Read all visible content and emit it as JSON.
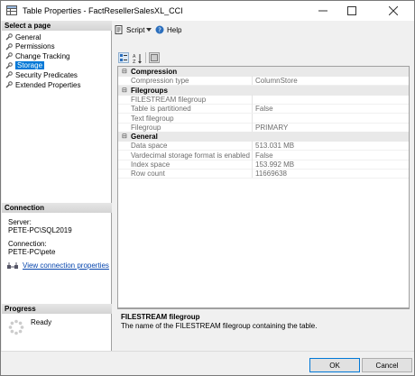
{
  "window": {
    "title": "Table Properties - FactResellerSalesXL_CCI"
  },
  "left": {
    "select_page_header": "Select a page",
    "pages": [
      {
        "label": "General",
        "selected": false
      },
      {
        "label": "Permissions",
        "selected": false
      },
      {
        "label": "Change Tracking",
        "selected": false
      },
      {
        "label": "Storage",
        "selected": true
      },
      {
        "label": "Security Predicates",
        "selected": false
      },
      {
        "label": "Extended Properties",
        "selected": false
      }
    ],
    "connection_header": "Connection",
    "server_label": "Server:",
    "server_value": "PETE-PC\\SQL2019",
    "connection_label": "Connection:",
    "connection_value": "PETE-PC\\pete",
    "view_connection_link": "View connection properties",
    "progress_header": "Progress",
    "progress_status": "Ready"
  },
  "toolbar": {
    "script_label": "Script",
    "help_label": "Help"
  },
  "grid": {
    "categories": [
      {
        "name": "Compression",
        "toggle": "⊟",
        "props": [
          {
            "name": "Compression type",
            "value": "ColumnStore"
          }
        ]
      },
      {
        "name": "Filegroups",
        "toggle": "⊟",
        "props": [
          {
            "name": "FILESTREAM filegroup",
            "value": ""
          },
          {
            "name": "Table is partitioned",
            "value": "False"
          },
          {
            "name": "Text filegroup",
            "value": ""
          },
          {
            "name": "Filegroup",
            "value": "PRIMARY"
          }
        ]
      },
      {
        "name": "General",
        "toggle": "⊟",
        "props": [
          {
            "name": "Data space",
            "value": "513.031 MB"
          },
          {
            "name": "Vardecimal storage format is enabled",
            "value": "False"
          },
          {
            "name": "Index space",
            "value": "153.992 MB"
          },
          {
            "name": "Row count",
            "value": "11669638"
          }
        ]
      }
    ]
  },
  "description": {
    "title": "FILESTREAM filegroup",
    "text": "The name of the FILESTREAM filegroup containing the table."
  },
  "buttons": {
    "ok": "OK",
    "cancel": "Cancel"
  },
  "colors": {
    "selection": "#0078d7",
    "link": "#0645ad",
    "category_bg": "#e9e9e9"
  }
}
